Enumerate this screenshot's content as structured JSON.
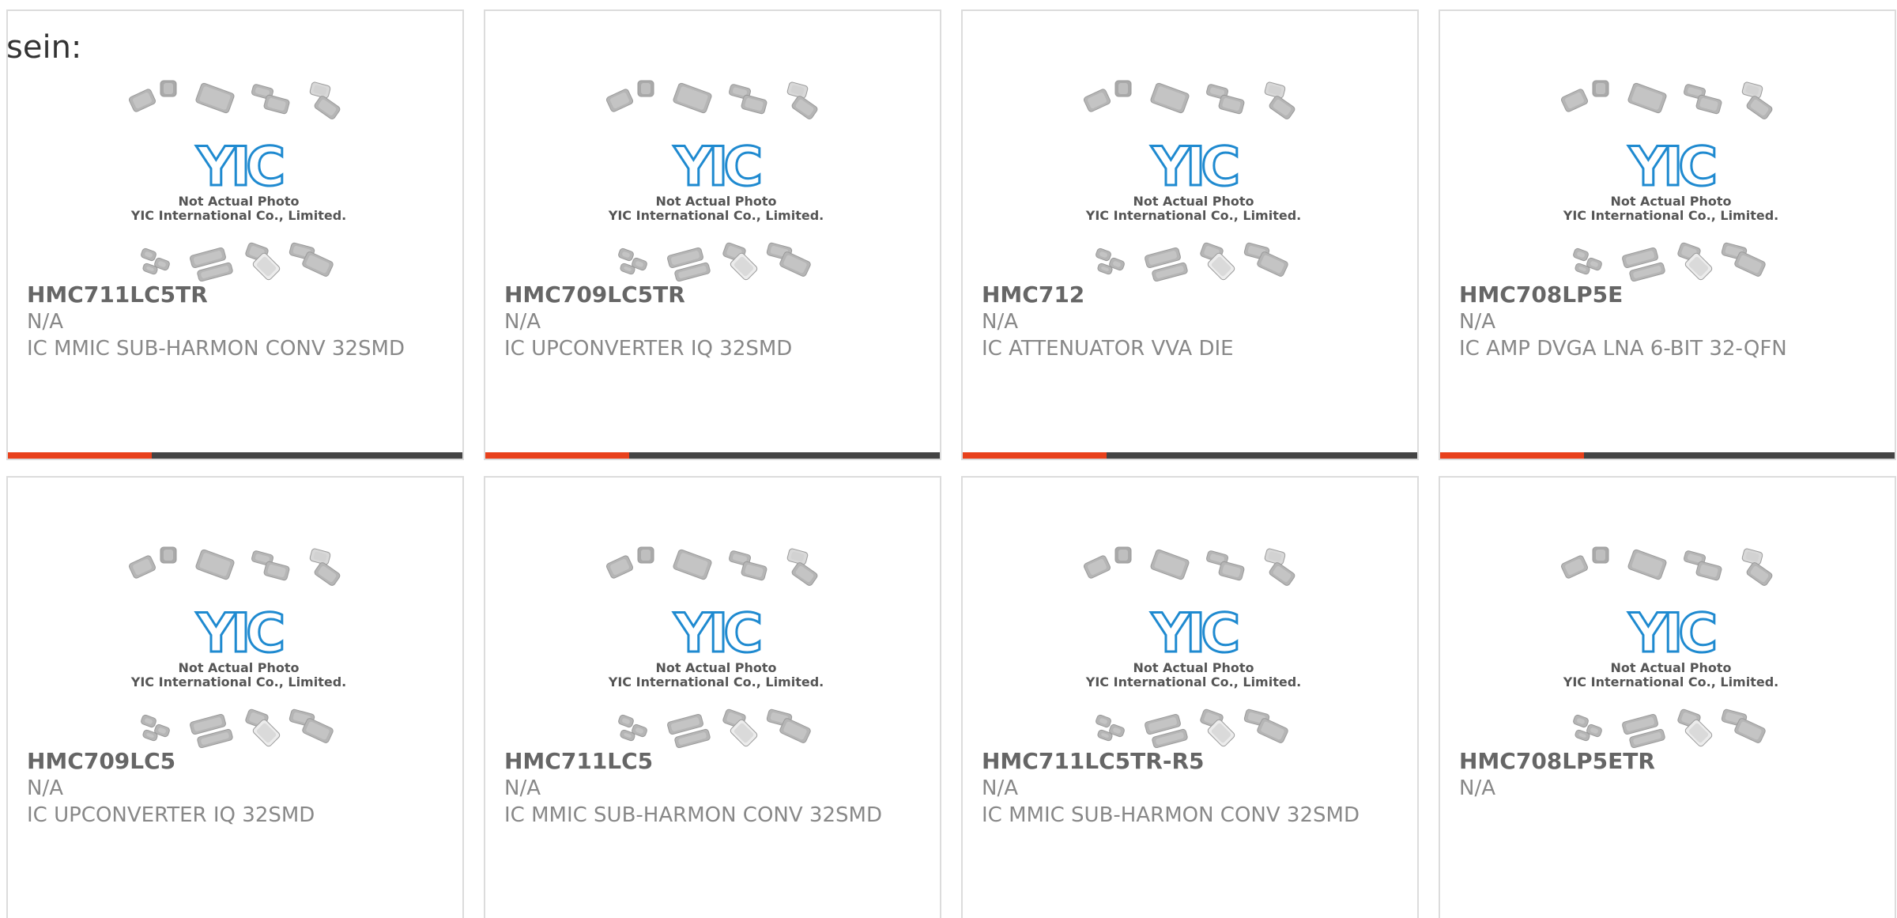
{
  "intro_text": "sein:",
  "thumbnail": {
    "logo_text": "YIC",
    "caption_line1": "Not Actual Photo",
    "caption_line2": "YIC International Co., Limited."
  },
  "colors": {
    "accent": "#e8411c",
    "bar": "#444444",
    "logo_blue": "#1f8ad0",
    "chip_grey": "#b5b5b5"
  },
  "cards": [
    {
      "part_number": "HMC711LC5TR",
      "manufacturer": "N/A",
      "description": "IC MMIC SUB-HARMON CONV 32SMD"
    },
    {
      "part_number": "HMC709LC5TR",
      "manufacturer": "N/A",
      "description": "IC UPCONVERTER IQ 32SMD"
    },
    {
      "part_number": "HMC712",
      "manufacturer": "N/A",
      "description": "IC ATTENUATOR VVA DIE"
    },
    {
      "part_number": "HMC708LP5E",
      "manufacturer": "N/A",
      "description": "IC AMP DVGA LNA 6-BIT 32-QFN"
    },
    {
      "part_number": "HMC709LC5",
      "manufacturer": "N/A",
      "description": "IC UPCONVERTER IQ 32SMD"
    },
    {
      "part_number": "HMC711LC5",
      "manufacturer": "N/A",
      "description": "IC MMIC SUB-HARMON CONV 32SMD"
    },
    {
      "part_number": "HMC711LC5TR-R5",
      "manufacturer": "N/A",
      "description": "IC MMIC SUB-HARMON CONV 32SMD"
    },
    {
      "part_number": "HMC708LP5ETR",
      "manufacturer": "N/A",
      "description": ""
    }
  ]
}
